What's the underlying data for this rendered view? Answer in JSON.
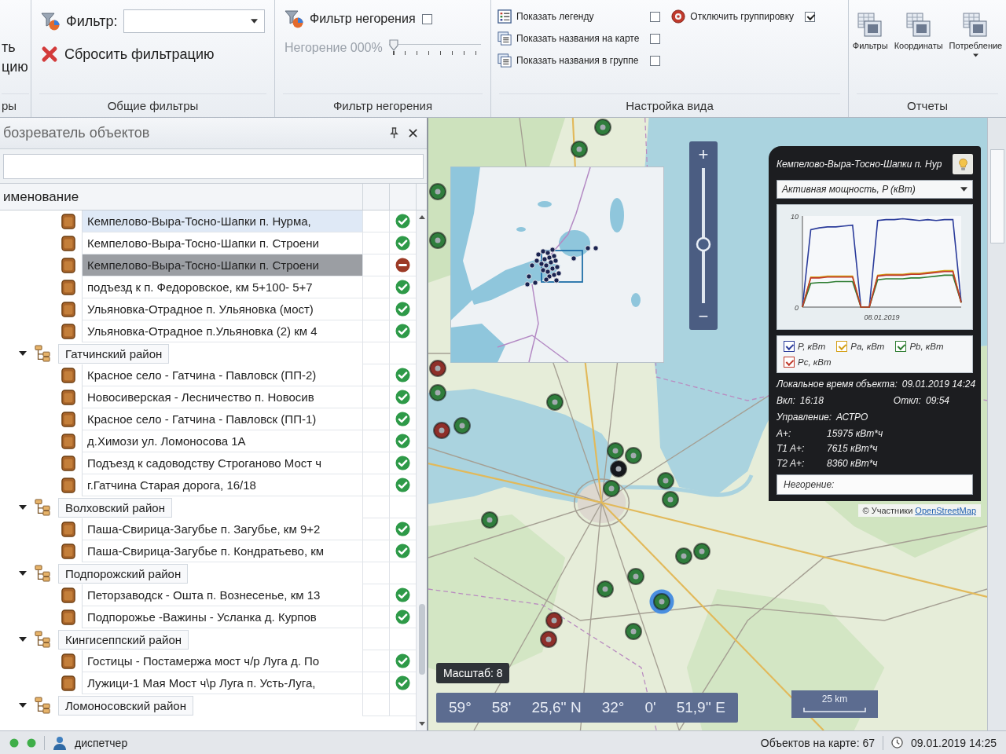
{
  "ribbon": {
    "cut_group": {
      "lines": [
        "ть",
        "цию"
      ],
      "caption": "ры"
    },
    "general_filters": {
      "filter_label": "Фильтр:",
      "reset_button": "Сбросить фильтрацию",
      "caption": "Общие фильтры"
    },
    "outage_filter": {
      "toggle": {
        "label": "Фильтр негорения",
        "checked": false
      },
      "slider": {
        "label": "Негорение 000%",
        "disabled": true,
        "level": 0
      },
      "caption": "Фильтр негорения"
    },
    "view_settings": {
      "options": [
        {
          "label": "Показать легенду",
          "checked": false
        },
        {
          "label": "Показать названия на карте",
          "checked": false
        },
        {
          "label": "Показать названия в группе",
          "checked": false
        },
        {
          "label": "Отключить группировку",
          "checked": true
        }
      ],
      "caption": "Настройка вида"
    },
    "reports": {
      "buttons": [
        {
          "label": "Фильтры",
          "dropdown": false
        },
        {
          "label": "Координаты",
          "dropdown": false
        },
        {
          "label": "Потребление",
          "dropdown": true
        }
      ],
      "caption": "Отчеты"
    }
  },
  "explorer": {
    "title": "бозреватель объектов",
    "column": "именование",
    "partial_group_children": [
      {
        "label": "Кемпелово-Выра-Тосно-Шапки п. Нурма,",
        "active": true,
        "selected": false,
        "hovered": true
      },
      {
        "label": "Кемпелово-Выра-Тосно-Шапки п. Строени",
        "active": true,
        "selected": false,
        "hovered": false
      },
      {
        "label": "Кемпелово-Выра-Тосно-Шапки п. Строени",
        "active": false,
        "selected": true,
        "hovered": false
      },
      {
        "label": "подъезд к п. Федоровское, км 5+100- 5+7",
        "active": true,
        "selected": false,
        "hovered": false
      },
      {
        "label": "Ульяновка-Отрадное п. Ульяновка (мост)",
        "active": true,
        "selected": false,
        "hovered": false
      },
      {
        "label": "Ульяновка-Отрадное п.Ульяновка (2) км 4",
        "active": true,
        "selected": false,
        "hovered": false
      }
    ],
    "groups": [
      {
        "label": "Гатчинский район",
        "expanded": true,
        "selected": false,
        "children": [
          {
            "label": "Красное село - Гатчина - Павловск (ПП-2)",
            "active": true,
            "selected": false,
            "hovered": false
          },
          {
            "label": "Новосиверская - Лесничество п. Новосив",
            "active": true,
            "selected": false,
            "hovered": false
          },
          {
            "label": "Красное село - Гатчина - Павловск (ПП-1)",
            "active": true,
            "selected": false,
            "hovered": false
          },
          {
            "label": "д.Химози ул. Ломоносова 1А",
            "active": true,
            "selected": false,
            "hovered": false
          },
          {
            "label": "Подъезд к садоводству Строганово Мост ч",
            "active": true,
            "selected": false,
            "hovered": false
          },
          {
            "label": "г.Гатчина Старая дорога, 16/18",
            "active": true,
            "selected": false,
            "hovered": false
          }
        ]
      },
      {
        "label": "Волховский район",
        "expanded": true,
        "selected": false,
        "children": [
          {
            "label": "Паша-Свирица-Загубье п. Загубье, км 9+2",
            "active": true,
            "selected": false,
            "hovered": false
          },
          {
            "label": "Паша-Свирица-Загубье п. Кондратьево, км",
            "active": true,
            "selected": false,
            "hovered": false
          }
        ]
      },
      {
        "label": "Подпорожский район",
        "expanded": true,
        "selected": false,
        "children": [
          {
            "label": "Петорзаводск - Ошта п. Вознесенье, км 13",
            "active": true,
            "selected": false,
            "hovered": false
          },
          {
            "label": "Подпорожье -Важины - Усланка д. Курпов",
            "active": true,
            "selected": false,
            "hovered": false
          }
        ]
      },
      {
        "label": "Кингисеппский район",
        "expanded": true,
        "selected": false,
        "children": [
          {
            "label": "Гостицы - Постамержа мост ч/р Луга д. По",
            "active": true,
            "selected": false,
            "hovered": false
          },
          {
            "label": "Лужици-1 Мая Мост ч\\р Луга п. Усть-Луга,",
            "active": true,
            "selected": false,
            "hovered": false
          }
        ]
      },
      {
        "label": "Ломоносовский район",
        "expanded": true,
        "selected": false
      }
    ]
  },
  "map": {
    "markers": [
      {
        "color": "#2f7d3c",
        "selected": false
      },
      {
        "color": "#2f7d3c",
        "selected": false
      },
      {
        "color": "#2f7d3c",
        "selected": false
      },
      {
        "color": "#2f7d3c",
        "selected": false
      },
      {
        "color": "#8e2f2a",
        "selected": false
      },
      {
        "color": "#2f7d3c",
        "selected": false
      },
      {
        "color": "#8e2f2a",
        "selected": false
      },
      {
        "color": "#2f7d3c",
        "selected": false
      },
      {
        "color": "#2f7d3c",
        "selected": false
      },
      {
        "color": "#2f7d3c",
        "selected": false
      },
      {
        "color": "#2f7d3c",
        "selected": false
      },
      {
        "color": "#15181c",
        "selected": false
      },
      {
        "color": "#2f7d3c",
        "selected": false
      },
      {
        "color": "#2f7d3c",
        "selected": false
      },
      {
        "color": "#2f7d3c",
        "selected": false
      },
      {
        "color": "#2f7d3c",
        "selected": false
      },
      {
        "color": "#2f7d3c",
        "selected": false
      },
      {
        "color": "#2f7d3c",
        "selected": false
      },
      {
        "color": "#2f7d3c",
        "selected": false
      },
      {
        "color": "#2f7d3c",
        "selected": false
      },
      {
        "color": "#2f7d3c",
        "selected": true
      },
      {
        "color": "#8e2f2a",
        "selected": false
      },
      {
        "color": "#8e2f2a",
        "selected": false
      },
      {
        "color": "#2f7d3c",
        "selected": false
      }
    ],
    "zoom": {
      "zoom_in": "+",
      "zoom_out": "−",
      "level": 0.43
    },
    "scale_badge": "Масштаб: 8",
    "coordinates": [
      "59°",
      "58'",
      "25,6'' N",
      "32°",
      "0'",
      "51,9'' E"
    ],
    "scale_bar": "25 km",
    "attribution": {
      "text": "© Участники",
      "link": "OpenStreetMap"
    }
  },
  "info_panel": {
    "title": "Кемпелово-Выра-Тосно-Шапки п. Нур",
    "parameter": "Активная мощность, P (кВт)",
    "chart_data": {
      "type": "line",
      "ylim": [
        0,
        10
      ],
      "yticks": [
        {
          "value": 0,
          "label": "0"
        },
        {
          "value": 10,
          "label": "10"
        }
      ],
      "annotations": [
        {
          "text": "08.01.2019"
        }
      ],
      "series": [
        {
          "name": "P, кВт",
          "color": "#2b3c9b",
          "values": [
            0,
            8.5,
            8.7,
            8.8,
            8.8,
            8.9,
            9.0,
            0,
            0,
            9.5,
            9.6,
            9.6,
            9.7,
            9.6,
            9.5,
            9.6,
            9.5,
            9.6,
            9.6,
            0.5
          ]
        },
        {
          "name": "Pa, кВт",
          "color": "#d4a017",
          "values": [
            0,
            3.3,
            3.3,
            3.4,
            3.4,
            3.4,
            3.4,
            0,
            0,
            3.5,
            3.6,
            3.6,
            3.6,
            3.7,
            3.7,
            3.8,
            3.9,
            4.0,
            4.0,
            0.5
          ]
        },
        {
          "name": "Pb, кВт",
          "color": "#2e7d32",
          "values": [
            0,
            2.6,
            2.7,
            2.7,
            2.8,
            2.8,
            2.8,
            0,
            0,
            3.0,
            3.1,
            3.1,
            3.1,
            3.2,
            3.2,
            3.3,
            3.4,
            3.5,
            3.5,
            0.5
          ]
        },
        {
          "name": "Pc, кВт",
          "color": "#c0392b",
          "values": [
            0,
            3.2,
            3.2,
            3.3,
            3.3,
            3.3,
            3.3,
            0,
            0,
            3.4,
            3.5,
            3.5,
            3.5,
            3.6,
            3.6,
            3.7,
            3.8,
            3.9,
            3.9,
            0.5
          ]
        }
      ]
    },
    "legend": [
      {
        "checked": true
      },
      {
        "checked": true
      },
      {
        "checked": true
      },
      {
        "checked": true
      }
    ],
    "local_time": {
      "label": "Локальное время объекта:",
      "value": "09.01.2019 14:24"
    },
    "switch_on": {
      "label": "Вкл:",
      "value": "16:18"
    },
    "switch_off": {
      "label": "Откл:",
      "value": "09:54"
    },
    "control": {
      "label": "Управление:",
      "value": "АСТРО"
    },
    "meters": [
      {
        "label": "A+:",
        "value": "15975 кВт*ч"
      },
      {
        "label": "T1 A+:",
        "value": "7615 кВт*ч"
      },
      {
        "label": "T2 A+:",
        "value": "8360 кВт*ч"
      }
    ],
    "outage_field": {
      "label": "Негорение:"
    }
  },
  "status_bar": {
    "indicators": [
      {
        "on": true
      },
      {
        "on": true
      }
    ],
    "user": "диспетчер",
    "objects": "Объектов на карте: 67",
    "datetime": "09.01.2019 14:25"
  }
}
